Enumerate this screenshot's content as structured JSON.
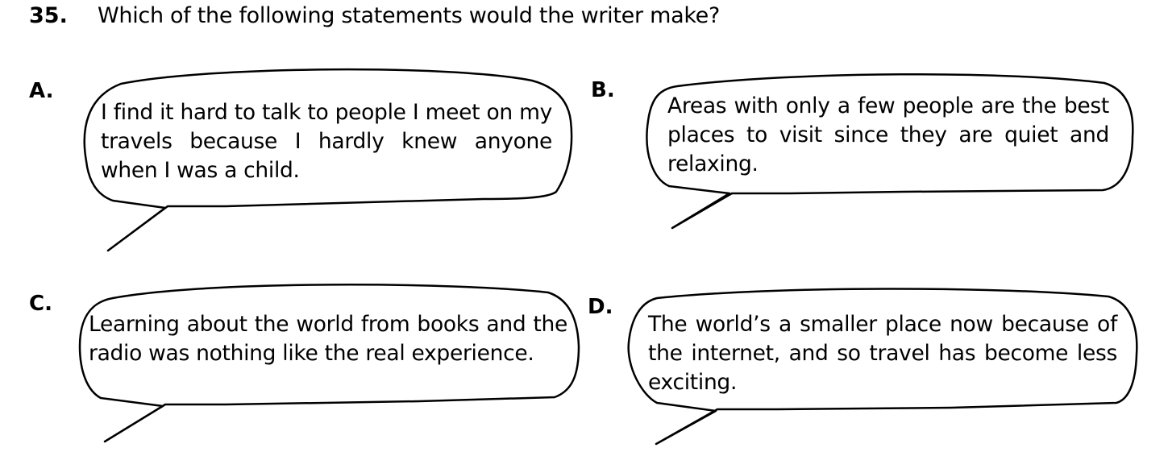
{
  "question": {
    "number": "35.",
    "text": "Which of the following statements would the writer make?"
  },
  "options": [
    {
      "letter": "A.",
      "text": "I find it hard to talk to people I meet on my travels because I hardly knew anyone when I was a child."
    },
    {
      "letter": "B.",
      "text": "Areas with only a few people are the best places to visit since they are quiet and relaxing."
    },
    {
      "letter": "C.",
      "text": "Learning about the world from books and the radio was nothing like the real experience."
    },
    {
      "letter": "D.",
      "text": "The world’s a smaller place now because of the internet, and so travel has become less exciting."
    }
  ]
}
